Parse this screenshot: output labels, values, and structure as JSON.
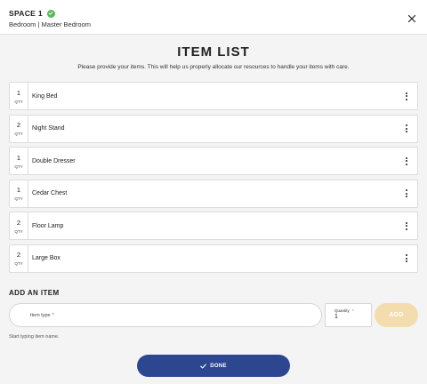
{
  "header": {
    "space_title": "SPACE 1",
    "space_subtitle": "Bedroom | Master Bedroom",
    "status_icon": "check-circle-icon",
    "close_icon": "close-icon"
  },
  "page": {
    "title": "ITEM LIST",
    "subtitle": "Please provide your items. This will help us properly allocate our resources to handle your items with care."
  },
  "items": [
    {
      "qty": "1",
      "qty_label": "QTY",
      "name": "King Bed"
    },
    {
      "qty": "2",
      "qty_label": "QTY",
      "name": "Night Stand"
    },
    {
      "qty": "1",
      "qty_label": "QTY",
      "name": "Double Dresser"
    },
    {
      "qty": "1",
      "qty_label": "QTY",
      "name": "Cedar Chest"
    },
    {
      "qty": "2",
      "qty_label": "QTY",
      "name": "Floor Lamp"
    },
    {
      "qty": "2",
      "qty_label": "QTY",
      "name": "Large Box"
    }
  ],
  "add_item": {
    "title": "ADD AN ITEM",
    "type_placeholder": "Item type",
    "required_mark": "*",
    "quantity_label": "Quantity",
    "quantity_value": "1",
    "add_label": "ADD",
    "hint": "Start typing item name."
  },
  "done_label": "DONE",
  "colors": {
    "primary": "#2c4690",
    "add_disabled": "#f3dcae",
    "success": "#5cb85c"
  }
}
